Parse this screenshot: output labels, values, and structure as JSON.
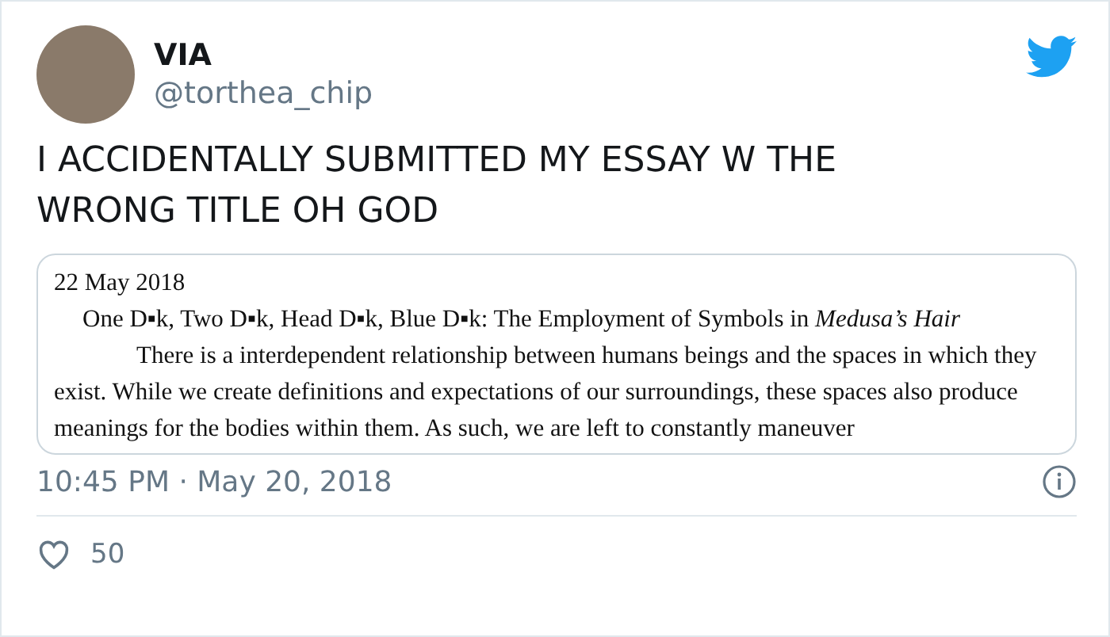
{
  "author": {
    "name": "VIA",
    "handle": "@torthea_chip"
  },
  "tweet_text": "I ACCIDENTALLY SUBMITTED MY ESSAY W THE WRONG TITLE OH GOD",
  "attached_document": {
    "date": "22 May 2018",
    "title": "One D▪k, Two D▪k, Head D▪k, Blue D▪k: The Employment of Symbols in *Medusa’s Hair*",
    "paragraph": "There is a interdependent relationship between humans beings and the spaces in which they exist. While we create definitions and expectations of our surroundings, these spaces also produce meanings for the bodies within them. As such, we are left to constantly maneuver"
  },
  "timestamp": "10:45 PM · May 20, 2018",
  "likes": "50"
}
